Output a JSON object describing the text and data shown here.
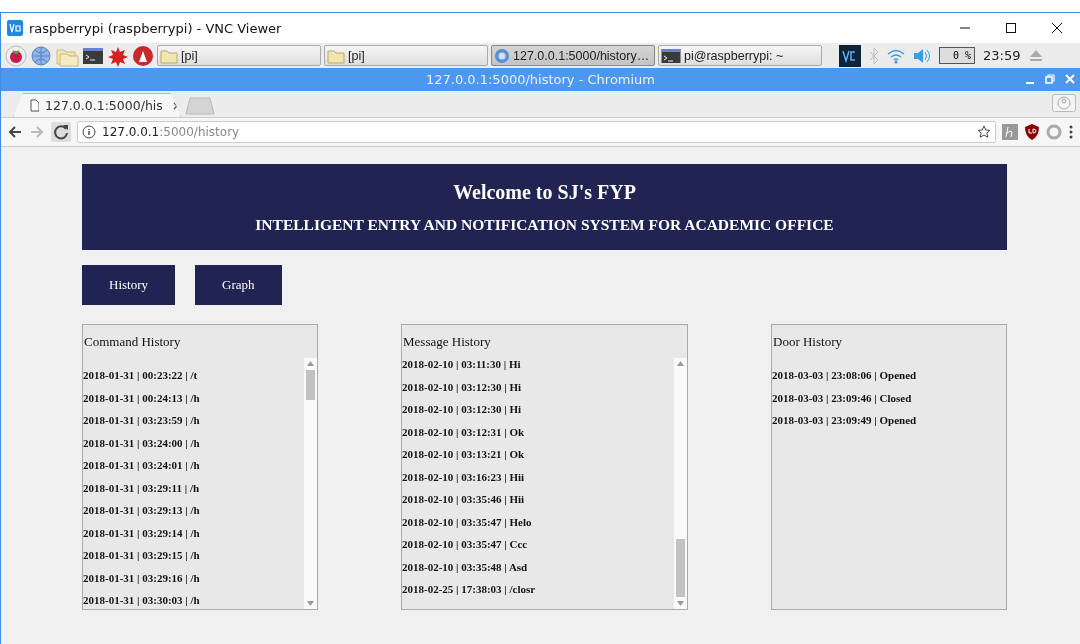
{
  "vnc_window": {
    "title": "raspberrypi (raspberrypi) - VNC Viewer"
  },
  "taskbar": {
    "tasks": [
      {
        "label": "[pi]",
        "kind": "folder",
        "selected": false
      },
      {
        "label": "[pi]",
        "kind": "folder",
        "selected": false
      },
      {
        "label": "127.0.0.1:5000/history…",
        "kind": "browser",
        "selected": true
      },
      {
        "label": "pi@raspberrypi: ~",
        "kind": "terminal",
        "selected": false
      }
    ],
    "cpu": "0 %",
    "clock": "23:59"
  },
  "browser": {
    "title": "127.0.0.1:5000/history - Chromium",
    "tabs": [
      {
        "label": "127.0.0.1:5000/his",
        "selected": true
      }
    ],
    "url_host": "127.0.0.1",
    "url_path": ":5000/history"
  },
  "page": {
    "title": "Welcome to SJ's FYP",
    "subtitle": "INTELLIGENT ENTRY AND NOTIFICATION SYSTEM FOR ACADEMIC OFFICE",
    "nav": [
      "History",
      "Graph"
    ],
    "panels": [
      {
        "title": "Command History",
        "scrollbar": true,
        "entries": [
          "2018-01-31 | 00:23:22 | /t",
          "2018-01-31 | 00:24:13 | /h",
          "2018-01-31 | 03:23:59 | /h",
          "2018-01-31 | 03:24:00 | /h",
          "2018-01-31 | 03:24:01 | /h",
          "2018-01-31 | 03:29:11 | /h",
          "2018-01-31 | 03:29:13 | /h",
          "2018-01-31 | 03:29:14 | /h",
          "2018-01-31 | 03:29:15 | /h",
          "2018-01-31 | 03:29:16 | /h",
          "2018-01-31 | 03:30:03 | /h"
        ]
      },
      {
        "title": "Message History",
        "scrollbar": true,
        "entries": [
          "2018-02-10 | 03:11:30 | Hi",
          "2018-02-10 | 03:12:30 | Hi",
          "2018-02-10 | 03:12:30 | Hi",
          "2018-02-10 | 03:12:31 | Ok",
          "2018-02-10 | 03:13:21 | Ok",
          "2018-02-10 | 03:16:23 | Hii",
          "2018-02-10 | 03:35:46 | Hii",
          "2018-02-10 | 03:35:47 | Helo",
          "2018-02-10 | 03:35:47 | Ccc",
          "2018-02-10 | 03:35:48 | Asd",
          "2018-02-25 | 17:38:03 | /closr"
        ]
      },
      {
        "title": "Door History",
        "scrollbar": false,
        "entries": [
          "2018-03-03 | 23:08:06 | Opened",
          "2018-03-03 | 23:09:46 | Closed",
          "2018-03-03 | 23:09:49 | Opened"
        ]
      }
    ]
  }
}
